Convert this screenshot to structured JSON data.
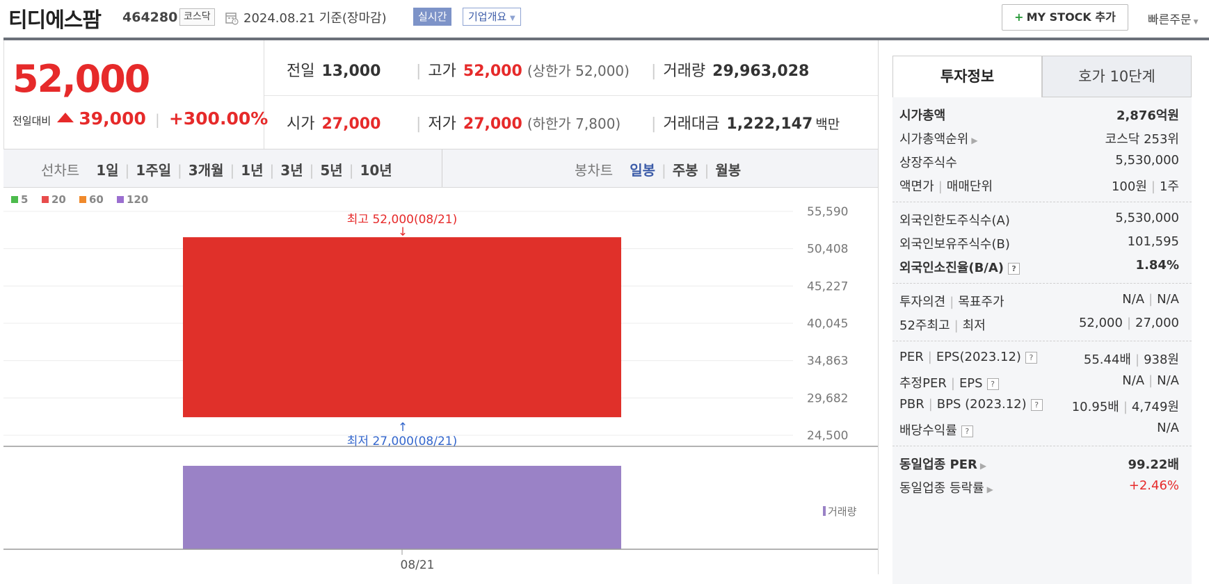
{
  "header": {
    "stock_name": "티디에스팜",
    "stock_code": "464280",
    "market": "코스닥",
    "calendar_icon": "calendar-icon",
    "date": "2024.08.21 기준(장마감)",
    "realtime_button": "실시간",
    "company_overview": "기업개요",
    "mystock_plus": "+",
    "mystock_button": "MY STOCK 추가",
    "quick_order": "빠른주문"
  },
  "price": {
    "current": "52,000",
    "change_label": "전일대비",
    "change_value": "39,000",
    "change_pct": "+300.00%",
    "colors": {
      "up": "#e62a2a",
      "down": "#3366cc"
    }
  },
  "stats": {
    "prev_label": "전일",
    "prev_value": "13,000",
    "high_label": "고가",
    "high_value": "52,000",
    "high_limit": "(상한가 52,000)",
    "volume_label": "거래량",
    "volume_value": "29,963,028",
    "open_label": "시가",
    "open_value": "27,000",
    "low_label": "저가",
    "low_value": "27,000",
    "low_limit": "(하한가 7,800)",
    "amount_label": "거래대금",
    "amount_value": "1,222,147",
    "amount_unit": "백만"
  },
  "chart_controls": {
    "line_chart_label": "선차트",
    "line_periods": [
      "1일",
      "1주일",
      "3개월",
      "1년",
      "3년",
      "5년",
      "10년"
    ],
    "candle_label": "봉차트",
    "candle_periods": [
      "일봉",
      "주봉",
      "월봉"
    ],
    "candle_active": "일봉"
  },
  "chart_data": {
    "type": "candlestick",
    "legend": [
      {
        "label": "5",
        "color": "#4cbb4c"
      },
      {
        "label": "20",
        "color": "#e84c4c"
      },
      {
        "label": "60",
        "color": "#f08a2c"
      },
      {
        "label": "120",
        "color": "#9b6fd0"
      }
    ],
    "y_ticks": [
      "55,590",
      "50,408",
      "45,227",
      "40,045",
      "34,863",
      "29,682",
      "24,500"
    ],
    "ylim": [
      24500,
      55590
    ],
    "candles": [
      {
        "date": "08/21",
        "open": 27000,
        "high": 52000,
        "low": 27000,
        "close": 52000,
        "color": "#e0302a"
      }
    ],
    "max_annotation": "최고 52,000(08/21)",
    "min_annotation": "최저 27,000(08/21)",
    "volume_label": "거래량",
    "volume_color": "#9a82c6",
    "volume": [
      29963028
    ],
    "x_labels": [
      "08/21"
    ]
  },
  "right_panel": {
    "tab_invest": "투자정보",
    "tab_orderbook": "호가 10단계",
    "market_cap_label": "시가총액",
    "market_cap_value": "2,876억원",
    "market_cap_rank_label": "시가총액순위",
    "market_cap_rank_value": "코스닥 253위",
    "listed_shares_label": "상장주식수",
    "listed_shares_value": "5,530,000",
    "face_label1": "액면가",
    "face_label2": "매매단위",
    "face_value1": "100원",
    "face_value2": "1주",
    "foreign_limit_label": "외국인한도주식수(A)",
    "foreign_limit_value": "5,530,000",
    "foreign_hold_label": "외국인보유주식수(B)",
    "foreign_hold_value": "101,595",
    "foreign_rate_label": "외국인소진율(B/A)",
    "foreign_rate_value": "1.84%",
    "opinion_label1": "투자의견",
    "opinion_label2": "목표주가",
    "opinion_value1": "N/A",
    "opinion_value2": "N/A",
    "w52_label1": "52주최고",
    "w52_label2": "최저",
    "w52_value1": "52,000",
    "w52_value2": "27,000",
    "per_label1": "PER",
    "per_label2": "EPS(2023.12)",
    "per_value1": "55.44배",
    "per_value2": "938원",
    "est_label1": "추정PER",
    "est_label2": "EPS",
    "est_value1": "N/A",
    "est_value2": "N/A",
    "pbr_label1": "PBR",
    "pbr_label2": "BPS (2023.12)",
    "pbr_value1": "10.95배",
    "pbr_value2": "4,749원",
    "div_label": "배당수익률",
    "div_value": "N/A",
    "sector_per_label": "동일업종 PER",
    "sector_per_value": "99.22배",
    "sector_chg_label": "동일업종 등락률",
    "sector_chg_value": "+2.46%",
    "help_mark": "?"
  }
}
